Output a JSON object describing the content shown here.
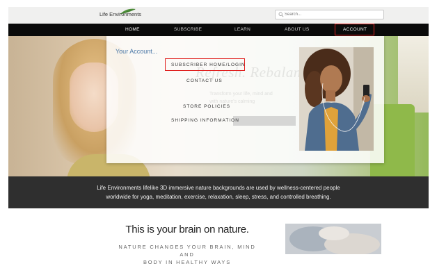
{
  "header": {
    "logo_text": "Life Environments",
    "search_placeholder": "Search..."
  },
  "nav": {
    "items": [
      {
        "label": "HOME"
      },
      {
        "label": "SUBSCRIBE"
      },
      {
        "label": "LEARN"
      },
      {
        "label": "ABOUT US"
      },
      {
        "label": "ACCOUNT"
      }
    ]
  },
  "hero": {
    "headline_faded": "Refresh. Rebalance.",
    "subtext_faded_1": "Transform your life, mind and",
    "subtext_faded_2": "with nature's calming"
  },
  "account_menu": {
    "title": "Your Account...",
    "items": [
      {
        "label": "SUBSCRIBER HOME/LOGIN"
      },
      {
        "label": "CONTACT US"
      },
      {
        "label": "STORE POLICIES"
      },
      {
        "label": "SHIPPING INFORMATION"
      }
    ]
  },
  "band": {
    "line1": "Life Environments lifelike 3D immersive nature backgrounds are used by wellness-centered people",
    "line2": "worldwide for yoga, meditation, exercise, relaxation, sleep, stress, and controlled breathing."
  },
  "section": {
    "heading": "This is your brain on nature.",
    "subheading_1": "NATURE CHANGES YOUR BRAIN, MIND AND",
    "subheading_2": "BODY IN HEALTHY WAYS"
  },
  "colors": {
    "nav_bg": "#0a0a0a",
    "highlight": "#e0201f",
    "menu_title": "#4a77a6",
    "band_bg": "#2f2f2f"
  }
}
